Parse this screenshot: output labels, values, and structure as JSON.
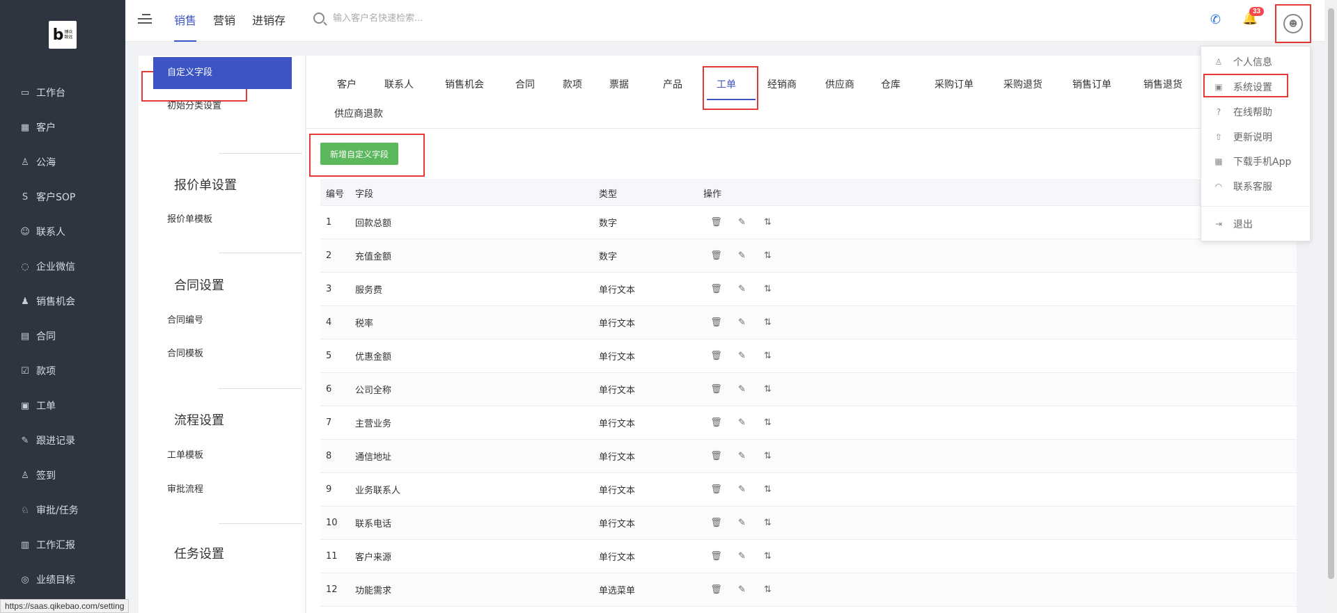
{
  "logo": {
    "letter": "b",
    "text": "博众\n致远"
  },
  "nav": {
    "items": [
      {
        "label": "工作台",
        "icon": "dashboard-icon",
        "glyph": "▭"
      },
      {
        "label": "客户",
        "icon": "customer-icon",
        "glyph": "▦"
      },
      {
        "label": "公海",
        "icon": "public-pool-icon",
        "glyph": "♙"
      },
      {
        "label": "客户SOP",
        "icon": "sop-icon",
        "glyph": "S"
      },
      {
        "label": "联系人",
        "icon": "contact-icon",
        "glyph": "☺"
      },
      {
        "label": "企业微信",
        "icon": "wechat-work-icon",
        "glyph": "◌"
      },
      {
        "label": "销售机会",
        "icon": "money-bag-icon",
        "glyph": "♟"
      },
      {
        "label": "合同",
        "icon": "contract-icon",
        "glyph": "▤"
      },
      {
        "label": "款项",
        "icon": "payment-icon",
        "glyph": "☑"
      },
      {
        "label": "工单",
        "icon": "work-order-icon",
        "glyph": "▣"
      },
      {
        "label": "跟进记录",
        "icon": "edit-record-icon",
        "glyph": "✎"
      },
      {
        "label": "签到",
        "icon": "checkin-icon",
        "glyph": "♙"
      },
      {
        "label": "审批/任务",
        "icon": "approval-icon",
        "glyph": "♘"
      },
      {
        "label": "工作汇报",
        "icon": "report-icon",
        "glyph": "▥"
      },
      {
        "label": "业绩目标",
        "icon": "target-icon",
        "glyph": "◎"
      }
    ]
  },
  "topbar": {
    "tabs": [
      {
        "label": "销售",
        "active": true
      },
      {
        "label": "营销",
        "active": false
      },
      {
        "label": "进销存",
        "active": false
      }
    ],
    "search_placeholder": "输入客户名快速检索...",
    "phone_glyph": "✆",
    "bell_glyph": "🔔",
    "notification_count": "33",
    "avatar_glyph": "☻"
  },
  "settings_menu": {
    "items": [
      {
        "label": "自定义字段",
        "active": true
      },
      {
        "label": "初始分类设置"
      },
      {
        "section": "报价单设置"
      },
      {
        "label": "报价单模板"
      },
      {
        "section": "合同设置"
      },
      {
        "label": "合同编号"
      },
      {
        "label": "合同模板"
      },
      {
        "section": "流程设置"
      },
      {
        "label": "工单模板"
      },
      {
        "label": "审批流程"
      },
      {
        "section": "任务设置"
      }
    ]
  },
  "content": {
    "tabs": [
      "客户",
      "联系人",
      "销售机会",
      "合同",
      "款项",
      "票据",
      "产品",
      "工单",
      "经销商",
      "供应商",
      "仓库",
      "采购订单",
      "采购退货",
      "销售订单",
      "销售退货",
      "供应商退款"
    ],
    "active_tab": "工单",
    "add_button": "新增自定义字段",
    "table": {
      "headers": {
        "no": "编号",
        "field": "字段",
        "type": "类型",
        "ops": "操作"
      },
      "op_glyphs": {
        "delete": "🗑",
        "edit": "✎",
        "sort": "⇅"
      },
      "rows": [
        {
          "no": "1",
          "field": "回款总额",
          "type": "数字"
        },
        {
          "no": "2",
          "field": "充值金额",
          "type": "数字"
        },
        {
          "no": "3",
          "field": "服务费",
          "type": "单行文本"
        },
        {
          "no": "4",
          "field": "税率",
          "type": "单行文本"
        },
        {
          "no": "5",
          "field": "优惠金额",
          "type": "单行文本"
        },
        {
          "no": "6",
          "field": "公司全称",
          "type": "单行文本"
        },
        {
          "no": "7",
          "field": "主营业务",
          "type": "单行文本"
        },
        {
          "no": "8",
          "field": "通信地址",
          "type": "单行文本"
        },
        {
          "no": "9",
          "field": "业务联系人",
          "type": "单行文本"
        },
        {
          "no": "10",
          "field": "联系电话",
          "type": "单行文本"
        },
        {
          "no": "11",
          "field": "客户来源",
          "type": "单行文本"
        },
        {
          "no": "12",
          "field": "功能需求",
          "type": "单选菜单"
        }
      ]
    }
  },
  "user_dropdown": {
    "items": [
      {
        "label": "个人信息",
        "icon": "user-icon",
        "glyph": "♙"
      },
      {
        "label": "系统设置",
        "icon": "system-settings-icon",
        "glyph": "▣"
      },
      {
        "label": "在线帮助",
        "icon": "help-icon",
        "glyph": "?"
      },
      {
        "label": "更新说明",
        "icon": "update-icon",
        "glyph": "⇧"
      },
      {
        "label": "下载手机App",
        "icon": "app-download-icon",
        "glyph": "▦"
      },
      {
        "label": "联系客服",
        "icon": "customer-service-icon",
        "glyph": "◠"
      },
      {
        "label": "退出",
        "icon": "logout-icon",
        "glyph": "⇥"
      }
    ]
  },
  "status_url": "https://saas.qikebao.com/setting",
  "colors": {
    "accent": "#3d54c4",
    "sidebar": "#2f3540",
    "add_button": "#5cb85c",
    "highlight": "#e53935",
    "badge": "#f5474d"
  }
}
